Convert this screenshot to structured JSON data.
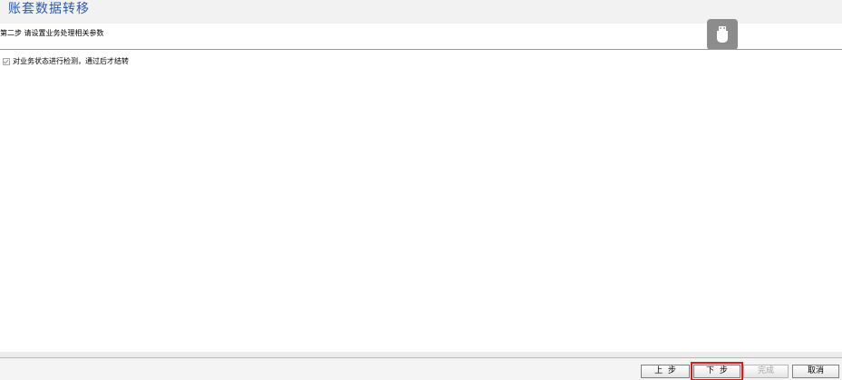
{
  "window": {
    "title": "账套数据转移"
  },
  "step": {
    "instruction": "第二步 请设置业务处理相关参数"
  },
  "options": {
    "check_business_status": {
      "label": "对业务状态进行检测，通过后才结转",
      "checked": true,
      "enabled": false
    }
  },
  "footer": {
    "prev_label": "上  步",
    "next_label": "下  步",
    "finish_label": "完成",
    "cancel_label": "取消"
  },
  "icons": {
    "usb_badge": "usb-drive-icon"
  },
  "colors": {
    "title": "#2c5aa0",
    "focus_outline": "#e01818"
  }
}
